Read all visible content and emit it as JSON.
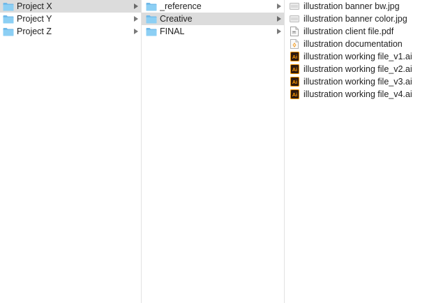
{
  "columns": [
    {
      "items": [
        {
          "label": "Project X",
          "icon": "folder-icon",
          "selected": true,
          "has_children": true
        },
        {
          "label": "Project Y",
          "icon": "folder-icon",
          "selected": false,
          "has_children": true
        },
        {
          "label": "Project Z",
          "icon": "folder-icon",
          "selected": false,
          "has_children": true
        }
      ]
    },
    {
      "items": [
        {
          "label": "_reference",
          "icon": "folder-icon",
          "selected": false,
          "has_children": true
        },
        {
          "label": "Creative",
          "icon": "folder-icon",
          "selected": true,
          "has_children": true
        },
        {
          "label": "FINAL",
          "icon": "folder-icon",
          "selected": false,
          "has_children": true
        }
      ]
    },
    {
      "items": [
        {
          "label": "illustration banner bw.jpg",
          "icon": "image-file-icon"
        },
        {
          "label": "illustration banner color.jpg",
          "icon": "image-file-icon"
        },
        {
          "label": "illustration client file.pdf",
          "icon": "pdf-file-icon"
        },
        {
          "label": "illustration documentation",
          "icon": "document-file-icon"
        },
        {
          "label": "illustration working file_v1.ai",
          "icon": "illustrator-file-icon"
        },
        {
          "label": "illustration working file_v2.ai",
          "icon": "illustrator-file-icon"
        },
        {
          "label": "illustration working file_v3.ai",
          "icon": "illustrator-file-icon"
        },
        {
          "label": "illustration working file_v4.ai",
          "icon": "illustrator-file-icon"
        }
      ]
    }
  ],
  "colors": {
    "folder_blue": "#7cc4ee",
    "selection_gray": "#dcdcdc",
    "illustrator_dark": "#2e1a0f",
    "illustrator_orange": "#ff9a00"
  }
}
